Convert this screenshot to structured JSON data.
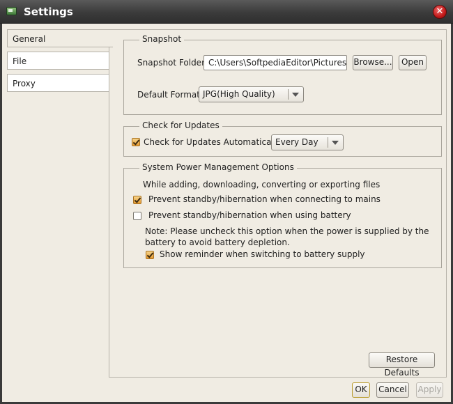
{
  "window": {
    "title": "Settings",
    "close_symbol": "✕"
  },
  "tabs": [
    {
      "label": "General",
      "active": true
    },
    {
      "label": "File",
      "active": false
    },
    {
      "label": "Proxy",
      "active": false
    }
  ],
  "snapshot": {
    "legend": "Snapshot",
    "folder_label": "Snapshot Folder:",
    "folder_value": "C:\\Users\\SoftpediaEditor\\Pictures",
    "browse_label": "Browse...",
    "open_label": "Open",
    "format_label": "Default Format:",
    "format_value": "JPG(High Quality)"
  },
  "updates": {
    "legend": "Check for Updates",
    "auto_label": "Check for Updates Automatically:",
    "auto_checked": true,
    "frequency_value": "Every Day"
  },
  "power": {
    "legend": "System Power Management Options",
    "intro": "While adding, downloading, converting or exporting files",
    "mains_label": "Prevent standby/hibernation when connecting to mains",
    "mains_checked": true,
    "battery_label": "Prevent standby/hibernation when using battery",
    "battery_checked": false,
    "note": "Note: Please uncheck this option when the power is supplied by the battery to avoid battery depletion.",
    "reminder_label": "Show reminder when switching to battery supply",
    "reminder_checked": true
  },
  "buttons": {
    "restore_defaults": "Restore Defaults",
    "ok": "OK",
    "cancel": "Cancel",
    "apply": "Apply"
  },
  "colors": {
    "window_bg": "#f0ece3",
    "titlebar": "#3b3b3b",
    "check_accent": "#e59a32",
    "close_red": "#c21a1a"
  }
}
